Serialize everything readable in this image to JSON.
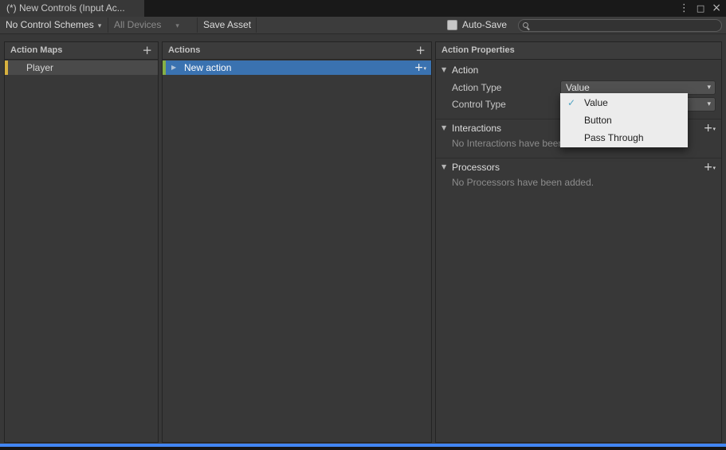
{
  "window": {
    "tab_title": "(*) New Controls (Input Ac...",
    "menu_icon": "⋮",
    "maximize_icon": "□",
    "close_icon": "×"
  },
  "icons": {
    "caret_down": "▾",
    "foldout_open": "▼",
    "disclosure": "▶",
    "plus": "+",
    "check": "✓"
  },
  "toolbar": {
    "control_schemes_label": "No Control Schemes",
    "all_devices_label": "All Devices",
    "save_asset_label": "Save Asset",
    "auto_save_label": "Auto-Save",
    "auto_save_checked": false,
    "search_value": ""
  },
  "panels": {
    "action_maps": {
      "title": "Action Maps",
      "items": [
        {
          "label": "Player"
        }
      ]
    },
    "actions": {
      "title": "Actions",
      "items": [
        {
          "label": "New action",
          "selected": true
        }
      ]
    },
    "properties": {
      "title": "Action Properties",
      "action_section": {
        "title": "Action",
        "fields": {
          "action_type": {
            "label": "Action Type",
            "value": "Value"
          },
          "control_type": {
            "label": "Control Type",
            "value": ""
          }
        }
      },
      "interactions": {
        "title": "Interactions",
        "empty_text": "No Interactions have been added."
      },
      "processors": {
        "title": "Processors",
        "empty_text": "No Processors have been added."
      }
    }
  },
  "dropdown_menu": {
    "items": [
      {
        "label": "Value",
        "check": "✓"
      },
      {
        "label": "Button",
        "check": ""
      },
      {
        "label": "Pass Through",
        "check": ""
      }
    ]
  },
  "colors": {
    "selection_blue": "#3a72b0",
    "action_map_tag": "#d7b13f",
    "action_tag": "#86b045",
    "popup_check": "#53a4c3",
    "bottom_accent": "#4286f4"
  }
}
